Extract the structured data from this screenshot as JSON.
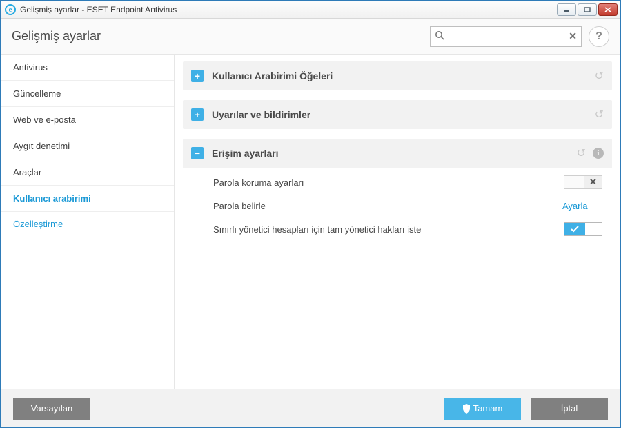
{
  "window": {
    "title": "Gelişmiş ayarlar - ESET Endpoint Antivirus"
  },
  "header": {
    "title": "Gelişmiş ayarlar",
    "search_placeholder": "",
    "help_label": "?"
  },
  "sidebar": {
    "items": [
      {
        "label": "Antivirus"
      },
      {
        "label": "Güncelleme"
      },
      {
        "label": "Web ve e-posta"
      },
      {
        "label": "Aygıt denetimi"
      },
      {
        "label": "Araçlar"
      },
      {
        "label": "Kullanıcı arabirimi",
        "selected": true
      }
    ],
    "sub": {
      "label": "Özelleştirme"
    }
  },
  "panels": {
    "ui_elements": {
      "title": "Kullanıcı Arabirimi Öğeleri",
      "expanded": false
    },
    "alerts": {
      "title": "Uyarılar ve bildirimler",
      "expanded": false
    },
    "access": {
      "title": "Erişim ayarları",
      "expanded": true,
      "rows": {
        "pw_protect": {
          "label": "Parola koruma ayarları"
        },
        "set_pw": {
          "label": "Parola belirle",
          "action": "Ayarla"
        },
        "full_admin": {
          "label": "Sınırlı yönetici hesapları için tam yönetici hakları iste"
        }
      }
    }
  },
  "footer": {
    "default_btn": "Varsayılan",
    "ok_btn": "Tamam",
    "cancel_btn": "İptal"
  }
}
